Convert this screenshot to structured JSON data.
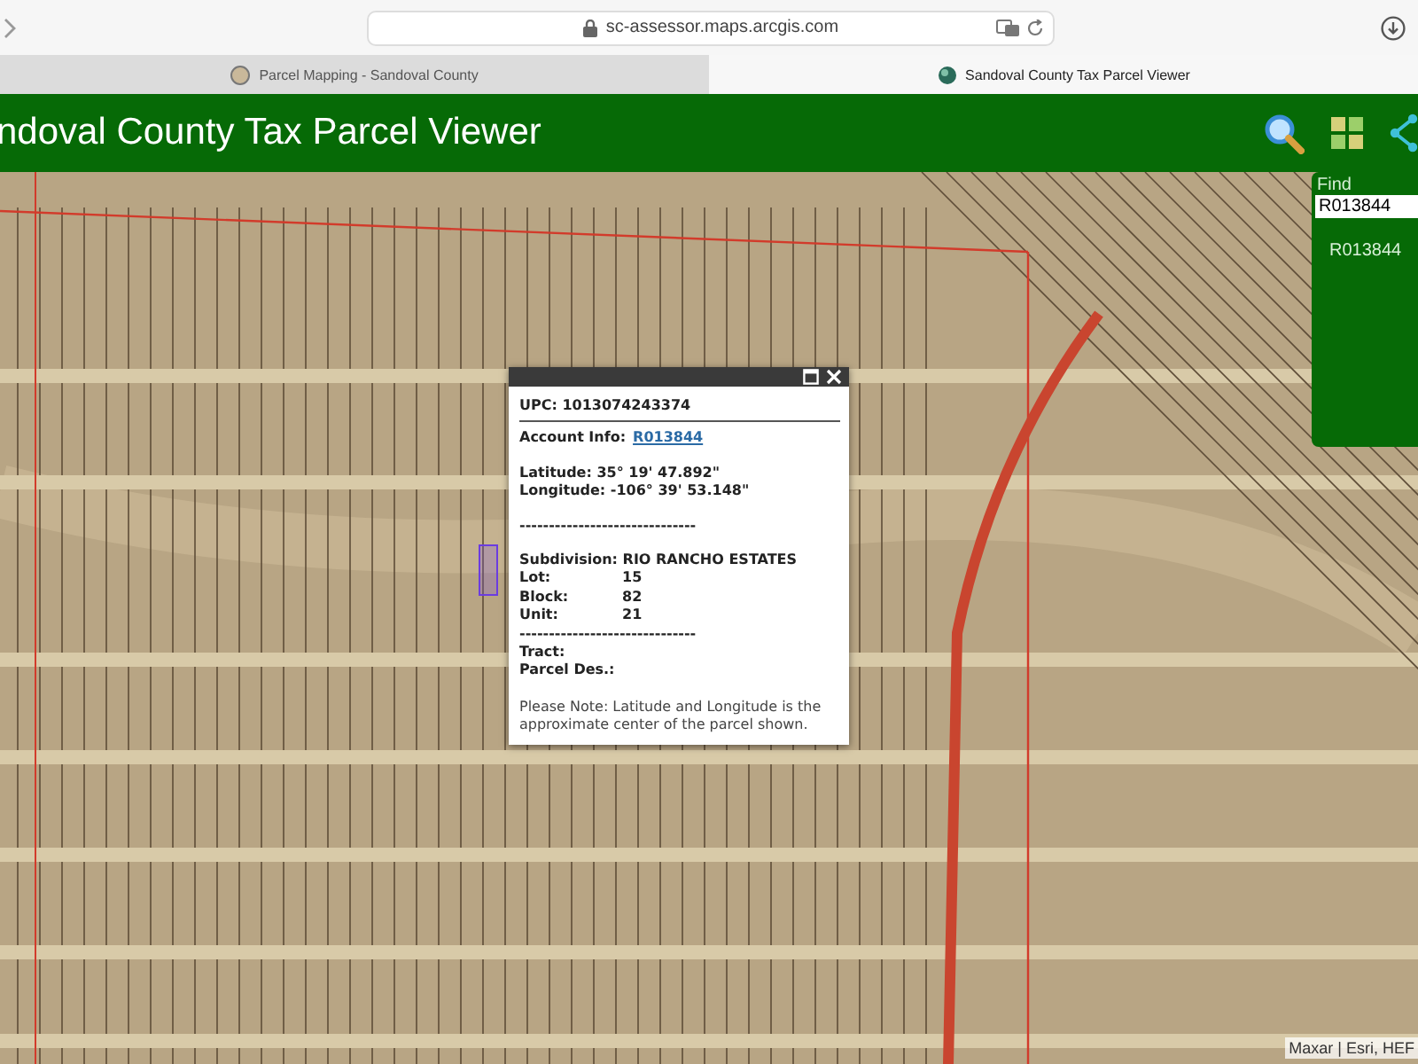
{
  "browser": {
    "address": "sc-assessor.maps.arcgis.com",
    "tabs": [
      {
        "label": "Parcel Mapping - Sandoval County",
        "selected": false
      },
      {
        "label": "Sandoval County Tax Parcel Viewer",
        "selected": true
      }
    ]
  },
  "header": {
    "title": "ndoval County Tax Parcel Viewer"
  },
  "find": {
    "label": "Find",
    "value": "R013844",
    "results": [
      "R013844"
    ]
  },
  "popup": {
    "upc": "UPC: 1013074243374",
    "account_label": "Account Info:",
    "account_link": "R013844",
    "coordinates": [
      "Latitude: 35° 19' 47.892\"",
      "Longitude: -106° 39' 53.148\""
    ],
    "separator": "------------------------------",
    "subdivision": "Subdivision: RIO RANCHO ESTATES",
    "fields": [
      {
        "label": "Lot:",
        "value": "15"
      },
      {
        "label": "Block:",
        "value": "82"
      },
      {
        "label": "Unit:",
        "value": "21"
      }
    ],
    "separator_2": "------------------------------",
    "empty_fields": [
      "Tract:",
      "Parcel Des.:"
    ],
    "note": "Please Note: Latitude and Longitude is the approximate center of the parcel shown."
  },
  "attribution": "Maxar | Esri, HEF"
}
